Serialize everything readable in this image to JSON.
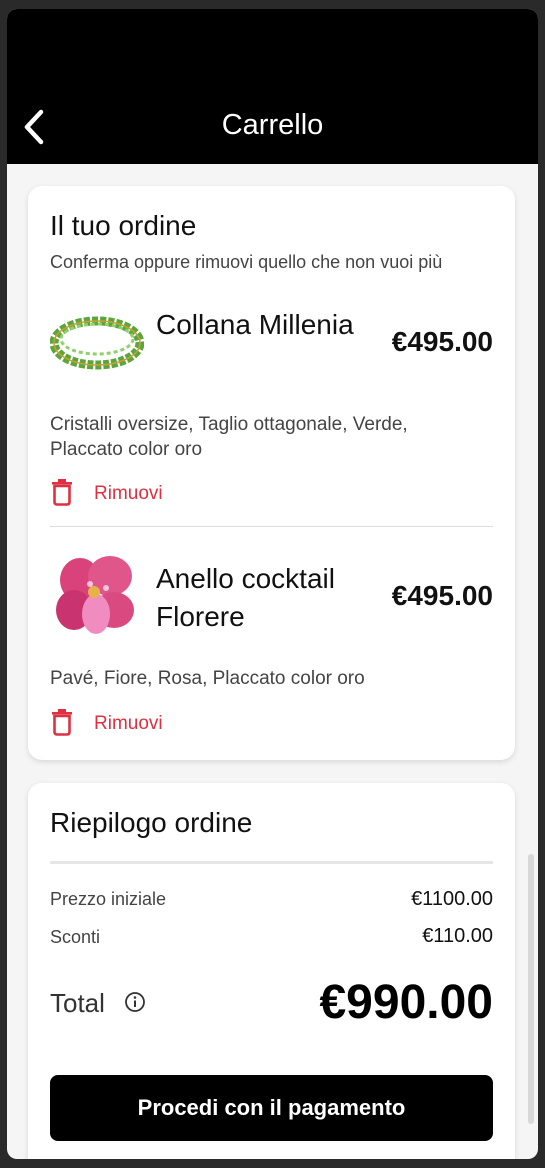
{
  "header": {
    "title": "Carrello"
  },
  "order": {
    "heading": "Il tuo ordine",
    "subtitle": "Conferma oppure rimuovi quello che non vuoi più",
    "items": [
      {
        "name": "Collana Millenia",
        "price": "€495.00",
        "description": "Cristalli oversize, Taglio ottagonale, Verde, Placcato color oro",
        "remove_label": "Rimuovi",
        "image": "green-crystal-necklace"
      },
      {
        "name": "Anello cocktail Florere",
        "price": "€495.00",
        "description": "Pavé, Fiore, Rosa, Placcato color oro",
        "remove_label": "Rimuovi",
        "image": "pink-flower-ring"
      }
    ]
  },
  "summary": {
    "heading": "Riepilogo ordine",
    "initial_price_label": "Prezzo iniziale",
    "initial_price_value": "€1100.00",
    "discount_label": "Sconti",
    "discount_value": "€110.00",
    "total_label": "Total",
    "total_value": "€990.00",
    "checkout_label": "Procedi con il pagamento"
  },
  "colors": {
    "accent": "#000000",
    "danger": "#e03040",
    "background": "#f5f5f5"
  }
}
